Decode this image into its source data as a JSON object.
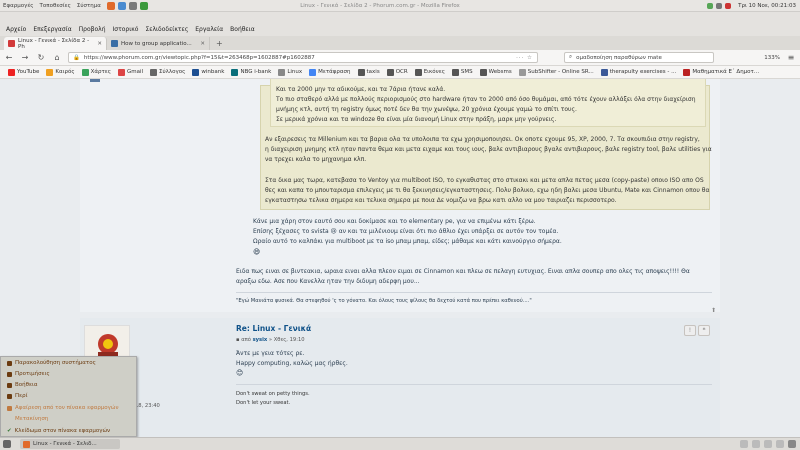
{
  "desktop": {
    "menu": [
      "Εφαρμογές",
      "Τοποθεσίες",
      "Σύστημα"
    ],
    "window_title": "Linux - Γενικά - Σελίδα 2 - Phorum.com.gr - Mozilla Firefox",
    "clock": "Τρι 10 Νοε, 00:21:03"
  },
  "browser": {
    "menus": [
      "Αρχείο",
      "Επεξεργασία",
      "Προβολή",
      "Ιστορικό",
      "Σελιδοδείκτες",
      "Εργαλεία",
      "Βοήθεια"
    ],
    "tabs": [
      {
        "label": "Linux - Γενικά - Σελίδα 2 - Ph"
      },
      {
        "label": "How to group applicatio..."
      }
    ],
    "url": "https://www.phorum.com.gr/viewtopic.php?f=15&t=263468p=1602887#p1602887",
    "search": "ομαδοποίηση παραθύρων mate",
    "zoom": "133%",
    "bookmarks": [
      "YouTube",
      "Καιρός",
      "Χάρτες",
      "Gmail",
      "Σύλλογος",
      "winbank",
      "NBG i-bank",
      "Linux",
      "Μετάφραση",
      "taxis",
      "OCR",
      "Εικόνες",
      "SMS",
      "Websms",
      "SubShifter - Online SR...",
      "therapulty exercises - ...",
      "Μαθηματικά Ε΄ Δημοτ..."
    ]
  },
  "quote": {
    "inner_lines": [
      "Και τα 2000 μην τα αδικούμε, και τα 7άρια ήτανε καλά.",
      "Το πιο σταθερό αλλά με πολλούς περιορισμούς στο hardware ήταν το 2000 από όσο θυμάμαι, από τότε έχουν αλλάξει όλα στην διαχείριση",
      "μνήμης κτλ, αυτή τη registry όμως ποτέ δεν θα την χωνέψω, 20 χρόνια έχουμε γαμώ το σπίτι τους.",
      "Σε μερικά χρόνια και τα windoze θα είναι μία διανομή Linux στην πράξη, μαρκ μην γούρνεις."
    ],
    "para1": [
      "Αν εξαιρεσεις τα Millenium και τα βαρια ολα τα υπολοιπα τα εχω χρησιμοποιησει. Οκ οποτε εχουμε 95, XP, 2000, 7. Τα σκουπιδια στην registry,",
      "η διαχειριση μνημης κτλ ηταν παντα θεμα και μετα ειχαμε και τους ιους, βαλε αντιβιαρους βγαλε αντιβιαρους, βαλε registry tool, βαλε utilities για",
      "να τρεχει καλα το μηχανημα κλπ."
    ],
    "para2": [
      "Στα δικα μας τωρα, κατεβασα το Ventoy για multiboot ISO, το εγκαθιστας στο στικακι και μετα απλα πετας μεσα (copy-paste) οποιο ISO απο OS",
      "θες και καπα το μπουταρισμα επιλεγεις με τι θα ξεκινησεις/εγκαταστησεις. Πολυ βολικο, εχω ηδη βαλει μεσα Ubuntu, Mate και Cinnamon οπου θα",
      "εγκαταστησω τελικα σημερα και τελικα σημερα με ποια Δε νομιζω να βρω κατι αλλο να μου ταιριαζει περισσοτερο."
    ],
    "para3": [
      "Κάνε μια χάρη στον εαυτό σου και δοκίμασε και το elementary pe, για να επιμένω κάτι ξέρω.",
      "Επίσης ξέχασες το svista 😢 αν και τα μιλένιουμ είναι ότι πιο άθλιο έχει υπάρξει σε αυτόν τον τομέα.",
      "Ωραίο αυτό το καλπάκι για multiboot με τα iso μπαμ μπαμ, είδες; μάθαμε και κάτι καινούργιο σήμερα."
    ]
  },
  "post1": {
    "body": [
      "Ειδα πως ειναι σε βιντεακια, ωραια ειναι αλλα πλεον ειμαι σε Cinnamon και πλεω σε πελαγη ευτυχιας. Ειναι απλα σουπερ απο ολες τις αποψεις!!!! Θα",
      "αραξω εδω. Ασε που Κανελλα ηταν την διδυμη αδερφη μου..."
    ],
    "signature": "\"Εγώ Μανιάτα φυσικά. Θα στεφηθού 'ς το γόνατο. Και όλους τους φίλους θα δεχτού κατά που πρέπει καθενού....\""
  },
  "post2": {
    "title": "Re: Linux - Γενικά",
    "meta_prefix": "από",
    "author": "sysix",
    "meta_suffix": "» Χθες, 19:10",
    "body": [
      "Άντε με γεια τότες ρε.",
      "Happy computing, καλώς μας ήρθες."
    ],
    "signature": [
      "Don't sweat on petty things.",
      "Don't let your sweat."
    ],
    "date_fragment": "18, 23:40"
  },
  "context_menu": {
    "items": [
      "Παρακολούθηση συστήματος",
      "Προτιμήσεις",
      "Βοήθεια",
      "Περί",
      "Αφαίρεση από τον πίνακα εφαρμογών",
      "Μετακίνηση",
      "Κλείδωμα στον πίνακα εφαρμογών"
    ]
  },
  "taskbar": {
    "task": "Linux - Γενικά - Σελιδ..."
  }
}
